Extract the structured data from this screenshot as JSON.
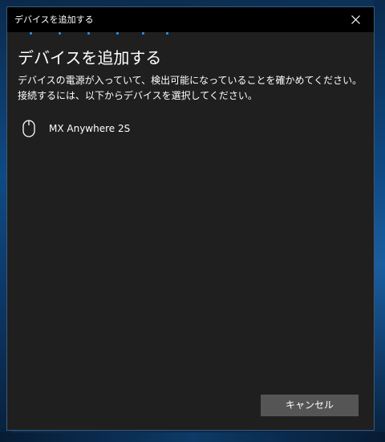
{
  "window": {
    "title": "デバイスを追加する"
  },
  "main": {
    "heading": "デバイスを追加する",
    "description": "デバイスの電源が入っていて、検出可能になっていることを確かめてください。接続するには、以下からデバイスを選択してください。"
  },
  "devices": [
    {
      "icon": "mouse-icon",
      "name": "MX Anywhere 2S"
    }
  ],
  "footer": {
    "cancel_label": "キャンセル"
  },
  "colors": {
    "accent": "#2b8fe8",
    "window_bg": "#1f1f1f",
    "titlebar_bg": "#000000",
    "button_bg": "#555555"
  }
}
